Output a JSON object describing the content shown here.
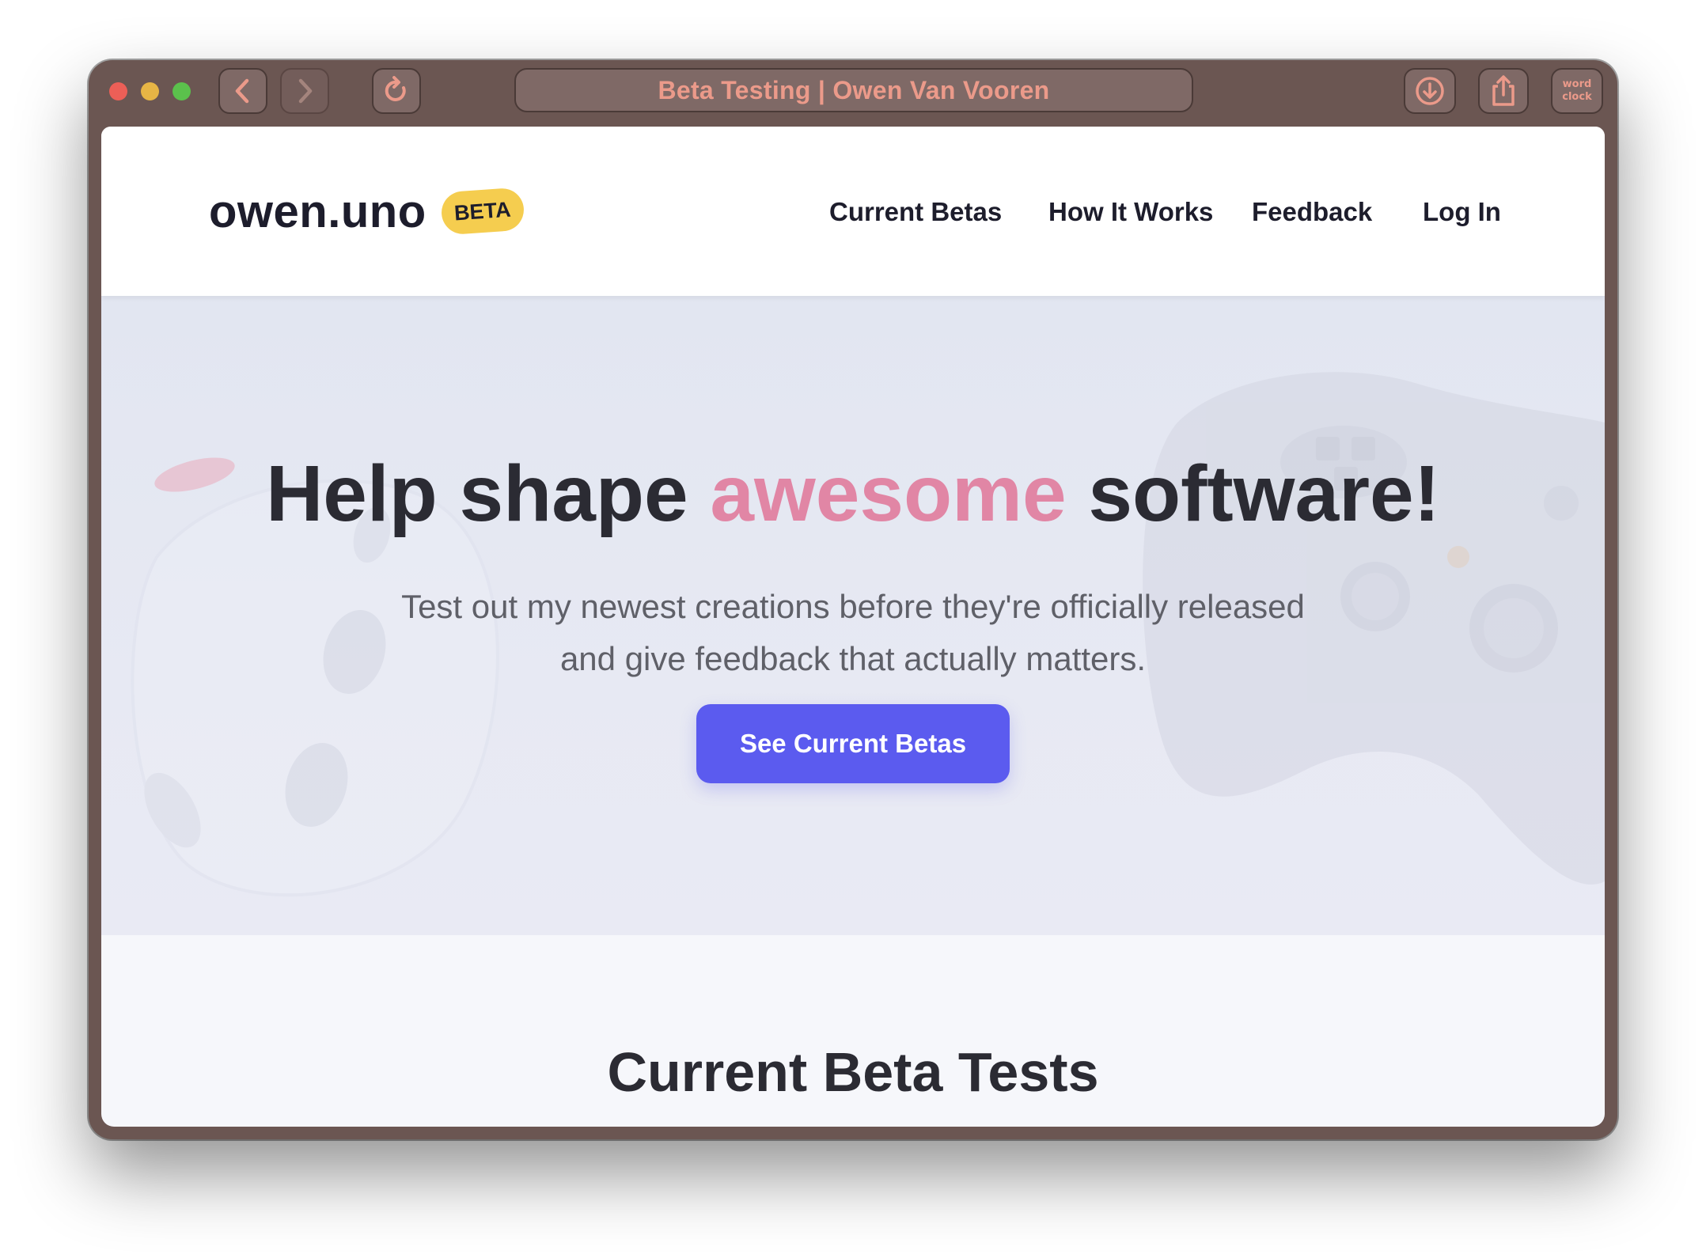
{
  "browser": {
    "address_text": "Beta Testing | Owen Van Vooren",
    "extension_line1": "word",
    "extension_line2": "clock",
    "icons": {
      "back": "chevron-left-icon",
      "forward": "chevron-right-icon",
      "reload": "reload-icon",
      "download": "download-icon",
      "share": "share-icon"
    },
    "colors": {
      "frame": "#6b5652",
      "address_text": "#eb9a8a",
      "close": "#ec5f57",
      "minimize": "#e7b545",
      "zoom": "#5bc14c"
    }
  },
  "nav": {
    "logo": "owen.uno",
    "badge": "BETA",
    "links": [
      "Current Betas",
      "How It Works",
      "Feedback",
      "Log In"
    ]
  },
  "hero": {
    "headline_before": "Help shape ",
    "headline_accent": "awesome",
    "headline_after": " software!",
    "subtitle": "Test out my newest creations before they're officially released and give feedback that actually matters.",
    "cta_label": "See Current Betas",
    "colors": {
      "accent": "#e186a5",
      "underline": "#ecd89a",
      "button": "#5b5bef",
      "badge": "#f5cd4f"
    }
  },
  "section": {
    "title": "Current Beta Tests"
  }
}
